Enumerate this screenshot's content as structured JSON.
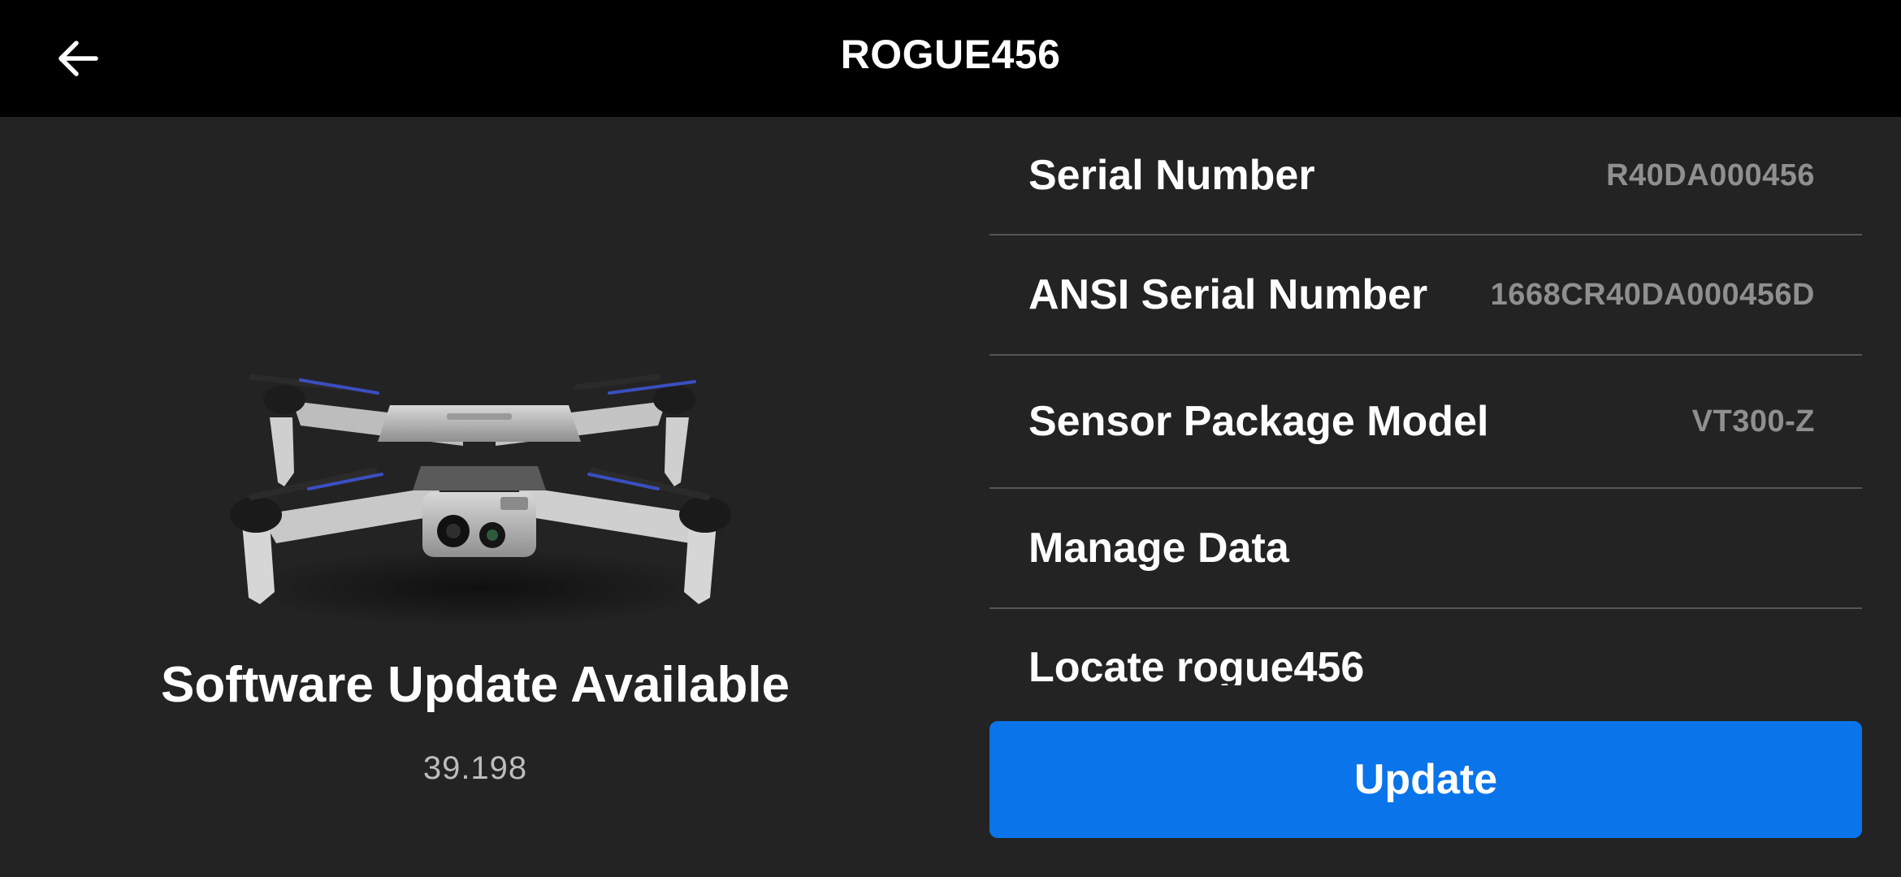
{
  "header": {
    "title": "ROGUE456",
    "back_icon": "arrow-left-icon"
  },
  "update_panel": {
    "heading": "Software Update Available",
    "version": "39.198",
    "image": "drone-image"
  },
  "details": [
    {
      "label": "Serial Number",
      "value": "R40DA000456"
    },
    {
      "label": "ANSI Serial Number",
      "value": "1668CR40DA000456D"
    },
    {
      "label": "Sensor Package Model",
      "value": "VT300-Z"
    },
    {
      "label": "Manage Data",
      "value": ""
    },
    {
      "label": "Locate rogue456",
      "value": ""
    }
  ],
  "update_button": {
    "label": "Update"
  },
  "colors": {
    "header_bg": "#000000",
    "page_bg": "#232323",
    "accent": "#0a74ea",
    "divider": "#555555",
    "secondary_text": "#8f8f8f"
  }
}
